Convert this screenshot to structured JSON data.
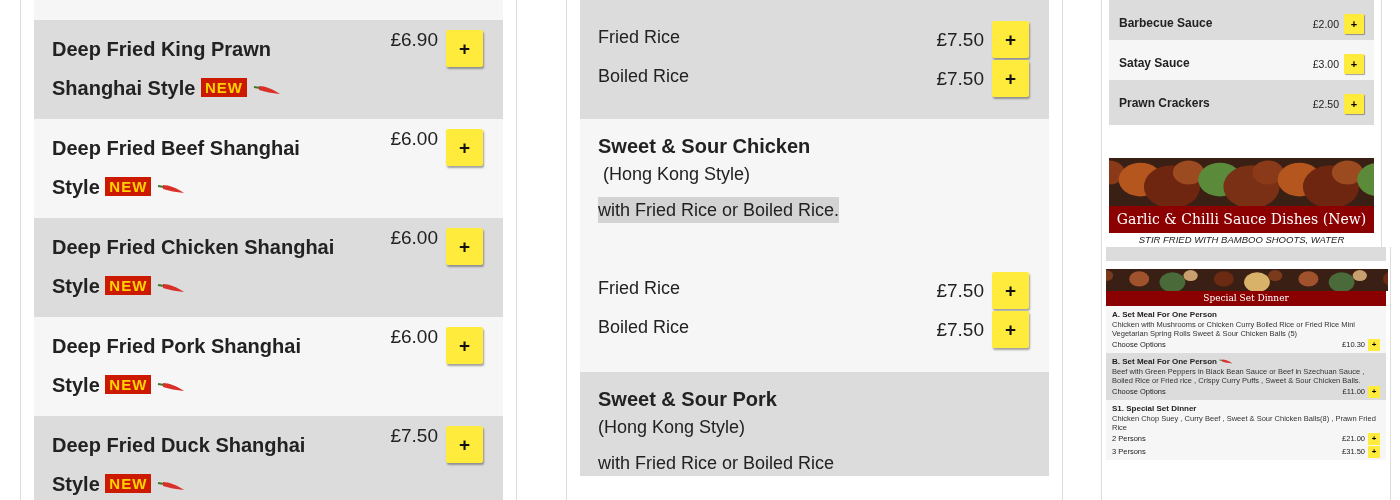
{
  "left_menu": {
    "items": [
      {
        "title": "Deep Fried King Prawn Shanghai Style",
        "badge": "NEW",
        "spicy": true,
        "price": "£6.90",
        "button": "+"
      },
      {
        "title": "Deep Fried Beef Shanghai Style",
        "badge": "NEW",
        "spicy": true,
        "price": "£6.00",
        "button": "+"
      },
      {
        "title": "Deep Fried Chicken Shanghai Style",
        "badge": "NEW",
        "spicy": true,
        "price": "£6.00",
        "button": "+"
      },
      {
        "title": "Deep Fried Pork Shanghai Style",
        "badge": "NEW",
        "spicy": true,
        "price": "£6.00",
        "button": "+"
      },
      {
        "title": "Deep Fried Duck Shanghai Style",
        "badge": "NEW",
        "spicy": true,
        "price": "£7.50",
        "button": "+"
      }
    ]
  },
  "middle_menu": {
    "items": [
      {
        "options": [
          {
            "label": "Fried Rice",
            "price": "£7.50",
            "button": "+"
          },
          {
            "label": "Boiled Rice",
            "price": "£7.50",
            "button": "+"
          }
        ]
      },
      {
        "title": "Sweet & Sour Chicken",
        "subtitle": " (Hong Kong Style)",
        "description": "with Fried Rice or Boiled Rice.",
        "highlighted": true,
        "options": [
          {
            "label": "Fried Rice",
            "price": "£7.50",
            "button": "+"
          },
          {
            "label": "Boiled Rice",
            "price": "£7.50",
            "button": "+"
          }
        ]
      },
      {
        "title": "Sweet & Sour Pork",
        "subtitle": "(Hong Kong Style)",
        "description": "with Fried Rice or Boiled Rice"
      }
    ]
  },
  "sauce_menu": {
    "items": [
      {
        "title": "Barbecue Sauce",
        "price": "£2.00",
        "button": "+"
      },
      {
        "title": "Satay Sauce",
        "price": "£3.00",
        "button": "+"
      },
      {
        "title": "Prawn Crackers",
        "price": "£2.50",
        "button": "+"
      }
    ],
    "banner": {
      "caption": "Garlic & Chilli Sauce Dishes (New)",
      "subtitle": "STIR FRIED WITH BAMBOO SHOOTS, WATER"
    }
  },
  "set_menu": {
    "banner": {
      "caption": "Special Set Dinner"
    },
    "items": [
      {
        "title": "A. Set Meal For One Person",
        "spicy": false,
        "description": "Chicken with Mushrooms or Chicken Curry Boiled Rice or Fried Rice Mini Vegetarian Spring Rolls Sweet & Sour Chicken Balls (5)",
        "options": [
          {
            "label": "Choose Options",
            "price": "£10.30",
            "button": "+"
          }
        ]
      },
      {
        "title": "B. Set Meal For One Person",
        "spicy": true,
        "description": "Beef with Green Peppers in Black Bean Sauce or Beef in Szechuan Sauce , Boiled Rice or Fried rice , Crispy Curry Puffs , Sweet & Sour Chicken Balls.",
        "options": [
          {
            "label": "Choose Options",
            "price": "£11.00",
            "button": "+"
          }
        ]
      },
      {
        "title": "S1. Special Set Dinner",
        "spicy": false,
        "description": "Chicken Chop Suey , Curry Beef , Sweet & Sour Chicken Balls(8) , Prawn Fried Rice",
        "options": [
          {
            "label": "2 Persons",
            "price": "£21.00",
            "button": "+"
          },
          {
            "label": "3 Persons",
            "price": "£31.50",
            "button": "+"
          }
        ]
      }
    ]
  }
}
